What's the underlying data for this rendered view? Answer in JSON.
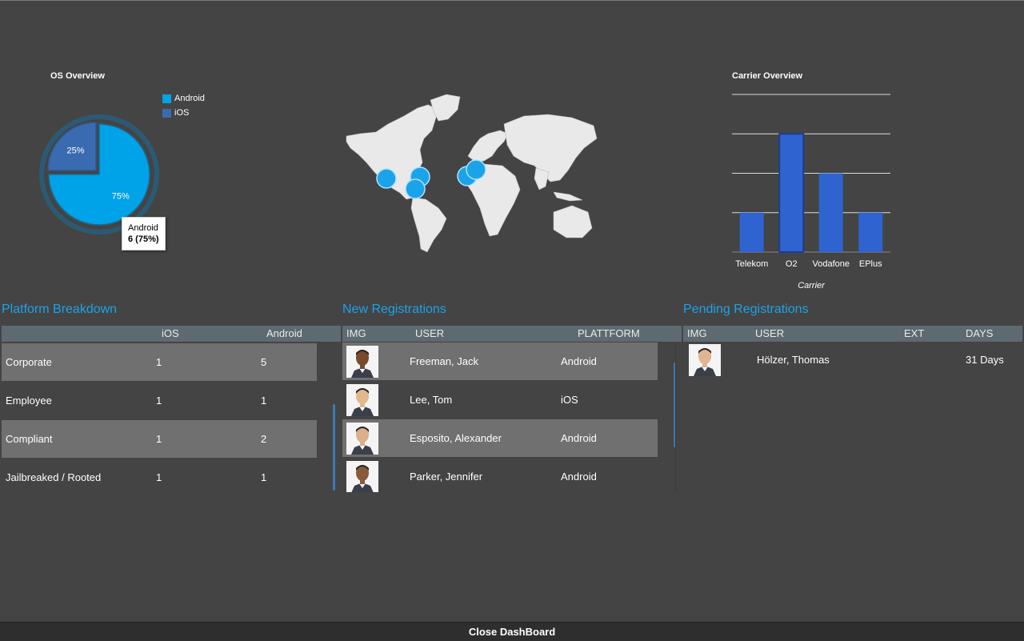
{
  "os_overview": {
    "title": "OS Overview",
    "legend": [
      {
        "label": "Android",
        "color": "#00a2e8"
      },
      {
        "label": "iOS",
        "color": "#3a6bb0"
      }
    ],
    "tooltip": {
      "label": "Android",
      "value": "6 (75%)"
    }
  },
  "carrier_overview": {
    "title": "Carrier Overview"
  },
  "chart_data": [
    {
      "type": "pie",
      "title": "OS Overview",
      "categories": [
        "Android",
        "iOS"
      ],
      "values": [
        75,
        25
      ],
      "value_labels": [
        "75%",
        "25%"
      ],
      "legend": "top-right"
    },
    {
      "type": "bar",
      "title": "Carrier Overview",
      "categories": [
        "Telekom",
        "O2",
        "Vodafone",
        "EPlus"
      ],
      "values": [
        1,
        3,
        2,
        1
      ],
      "xlabel": "Carrier",
      "ylabel": "",
      "ylim": [
        0,
        4
      ],
      "grid": true,
      "color": "#2f63d0"
    }
  ],
  "map": {
    "markers": [
      {
        "name": "us-west"
      },
      {
        "name": "us-east"
      },
      {
        "name": "us-south"
      },
      {
        "name": "europe-west"
      },
      {
        "name": "europe-central"
      }
    ]
  },
  "platform": {
    "title": "Platform Breakdown",
    "headers": [
      "iOS",
      "Android"
    ],
    "rows": [
      {
        "label": "Corporate",
        "ios": "1",
        "android": "5"
      },
      {
        "label": "Employee",
        "ios": "1",
        "android": "1"
      },
      {
        "label": "Compliant",
        "ios": "1",
        "android": "2"
      },
      {
        "label": "Jailbreaked / Rooted",
        "ios": "1",
        "android": "1"
      }
    ]
  },
  "new_reg": {
    "title": "New Registrations",
    "headers": [
      "IMG",
      "USER",
      "PLATTFORM"
    ],
    "rows": [
      {
        "user": "Freeman, Jack",
        "platform": "Android",
        "skin": "#7a4a2c"
      },
      {
        "user": "Lee, Tom",
        "platform": "iOS",
        "skin": "#e2b88e"
      },
      {
        "user": "Esposito, Alexander",
        "platform": "Android",
        "skin": "#dcae8a"
      },
      {
        "user": "Parker, Jennifer",
        "platform": "Android",
        "skin": "#8a5a3c"
      }
    ]
  },
  "pending_reg": {
    "title": "Pending Registrations",
    "headers": [
      "IMG",
      "USER",
      "EXT",
      "DAYS"
    ],
    "rows": [
      {
        "user": "Hölzer, Thomas",
        "ext": "",
        "days": "31 Days",
        "skin": "#e0b592"
      }
    ]
  },
  "footer": {
    "close_label": "Close DashBoard"
  }
}
